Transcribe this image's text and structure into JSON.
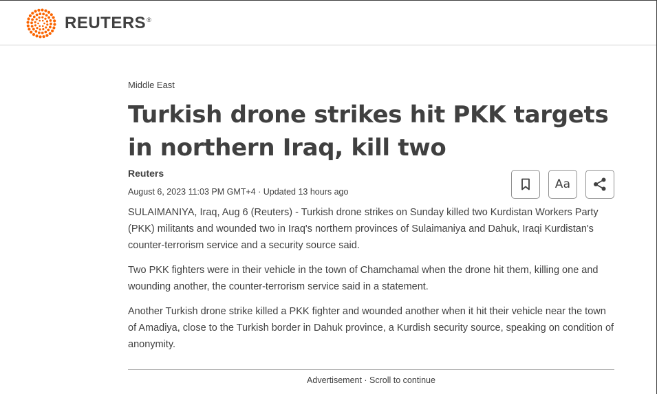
{
  "header": {
    "brand_name": "REUTERS",
    "brand_mark": "®",
    "logo_icon": "reuters-dot-logo",
    "accent_color": "#fa6400"
  },
  "article": {
    "section": "Middle East",
    "headline": "Turkish drone strikes hit PKK targets in northern Iraq, kill two",
    "byline": "Reuters",
    "dateline": "August 6, 2023 11:03 PM GMT+4 · Updated 13 hours ago",
    "paragraphs": [
      "SULAIMANIYA, Iraq, Aug 6 (Reuters) - Turkish drone strikes on Sunday killed two Kurdistan Workers Party (PKK) militants and wounded two in Iraq's northern provinces of Sulaimaniya and Dahuk, Iraqi Kurdistan's counter-terrorism service and a security source said.",
      "Two PKK fighters were in their vehicle in the town of Chamchamal when the drone hit them, killing one and wounding another, the counter-terrorism service said in a statement.",
      "Another Turkish drone strike killed a PKK fighter and wounded another when it hit their vehicle near the town of Amadiya, close to the Turkish border in Dahuk province, a Kurdish security source, speaking on condition of anonymity."
    ]
  },
  "tools": {
    "bookmark_icon": "bookmark-icon",
    "text_size_label": "Aa",
    "share_icon": "share-icon"
  },
  "ad": {
    "label": "Advertisement · Scroll to continue"
  }
}
